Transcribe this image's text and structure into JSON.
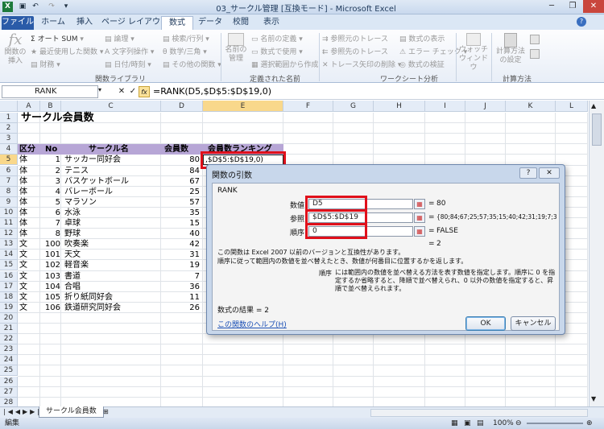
{
  "window": {
    "title": "03_サークル管理 [互換モード] - Microsoft Excel",
    "app_icon": "X"
  },
  "quick_access": [
    "save-icon",
    "undo-icon",
    "redo-icon"
  ],
  "tabs": [
    {
      "label": "ファイル"
    },
    {
      "label": "ホーム"
    },
    {
      "label": "挿入"
    },
    {
      "label": "ページ レイアウト"
    },
    {
      "label": "数式"
    },
    {
      "label": "データ"
    },
    {
      "label": "校閲"
    },
    {
      "label": "表示"
    }
  ],
  "ribbon": {
    "insert_function": "関数の挿入",
    "autosum": "オート SUM",
    "recent": "最近使用した関数",
    "financial": "財務",
    "logical": "論理",
    "text": "文字列操作",
    "datetime": "日付/時刻",
    "lookup": "検索/行列",
    "math": "数学/三角",
    "more": "その他の関数",
    "group_library": "関数ライブラリ",
    "name_manager": "名前の管理",
    "define_name": "名前の定義",
    "use_in_formula": "数式で使用",
    "create_from_sel": "選択範囲から作成",
    "group_names": "定義された名前",
    "trace_prec": "参照元のトレース",
    "trace_dep": "参照先のトレース",
    "remove_arrows": "トレース矢印の削除",
    "show_formulas": "数式の表示",
    "error_check": "エラー チェック",
    "evaluate": "数式の検証",
    "watch": "ウォッチ ウィンドウ",
    "group_audit": "ワークシート分析",
    "calc_options": "計算方法の設定",
    "group_calc": "計算方法"
  },
  "formula_bar": {
    "name_box": "RANK",
    "fx": "fx",
    "formula": "=RANK(D5,$D$5:$D$19,0)"
  },
  "columns": [
    "A",
    "B",
    "C",
    "D",
    "E",
    "F",
    "G",
    "H",
    "I",
    "J",
    "K",
    "L"
  ],
  "sheet": {
    "title": "サークル会員数",
    "headers": [
      "区分",
      "No",
      "サークル名",
      "会員数",
      "会員数ランキング"
    ],
    "editing_cell": ",$D$5:$D$19,0)",
    "rows": [
      {
        "kubun": "体",
        "no": "1",
        "name": "サッカー同好会",
        "count": "80"
      },
      {
        "kubun": "体",
        "no": "2",
        "name": "テニス",
        "count": "84"
      },
      {
        "kubun": "体",
        "no": "3",
        "name": "バスケットボール",
        "count": "67"
      },
      {
        "kubun": "体",
        "no": "4",
        "name": "バレーボール",
        "count": "25"
      },
      {
        "kubun": "体",
        "no": "5",
        "name": "マラソン",
        "count": "57"
      },
      {
        "kubun": "体",
        "no": "6",
        "name": "水泳",
        "count": "35"
      },
      {
        "kubun": "体",
        "no": "7",
        "name": "卓球",
        "count": "15"
      },
      {
        "kubun": "体",
        "no": "8",
        "name": "野球",
        "count": "40"
      },
      {
        "kubun": "文",
        "no": "100",
        "name": "吹奏楽",
        "count": "42"
      },
      {
        "kubun": "文",
        "no": "101",
        "name": "天文",
        "count": "31"
      },
      {
        "kubun": "文",
        "no": "102",
        "name": "軽音楽",
        "count": "19"
      },
      {
        "kubun": "文",
        "no": "103",
        "name": "書道",
        "count": "7"
      },
      {
        "kubun": "文",
        "no": "104",
        "name": "合唱",
        "count": "36"
      },
      {
        "kubun": "文",
        "no": "105",
        "name": "折り紙同好会",
        "count": "11"
      },
      {
        "kubun": "文",
        "no": "106",
        "name": "鉄道研究同好会",
        "count": "26"
      }
    ]
  },
  "dialog": {
    "title": "関数の引数",
    "function": "RANK",
    "arg1_label": "数値",
    "arg1_value": "D5",
    "arg1_result": "80",
    "arg2_label": "参照",
    "arg2_value": "$D$5:$D$19",
    "arg2_result": "{80;84;67;25;57;35;15;40;42;31;19;7;36;11;2",
    "arg3_label": "順序",
    "arg3_value": "0",
    "arg3_result": "FALSE",
    "eq": "=",
    "func_result": "2",
    "compat_note": "この関数は Excel 2007 以前のバージョンと互換性があります。",
    "desc": "順序に従って範囲内の数値を並べ替えたとき、数値が何番目に位置するかを返します。",
    "arg_help_label": "順序",
    "arg_help": "には範囲内の数値を並べ替える方法を表す数値を指定します。順序に 0 を指定するか省略すると、降順で並べ替えられ、0 以外の数値を指定すると、昇順で並べ替えられます。",
    "formula_result": "数式の結果 =  2",
    "help_link": "この関数のヘルプ(H)",
    "ok": "OK",
    "cancel": "キャンセル"
  },
  "sheet_tab": "サークル会員数",
  "status": {
    "mode": "編集",
    "zoom": "100%"
  }
}
